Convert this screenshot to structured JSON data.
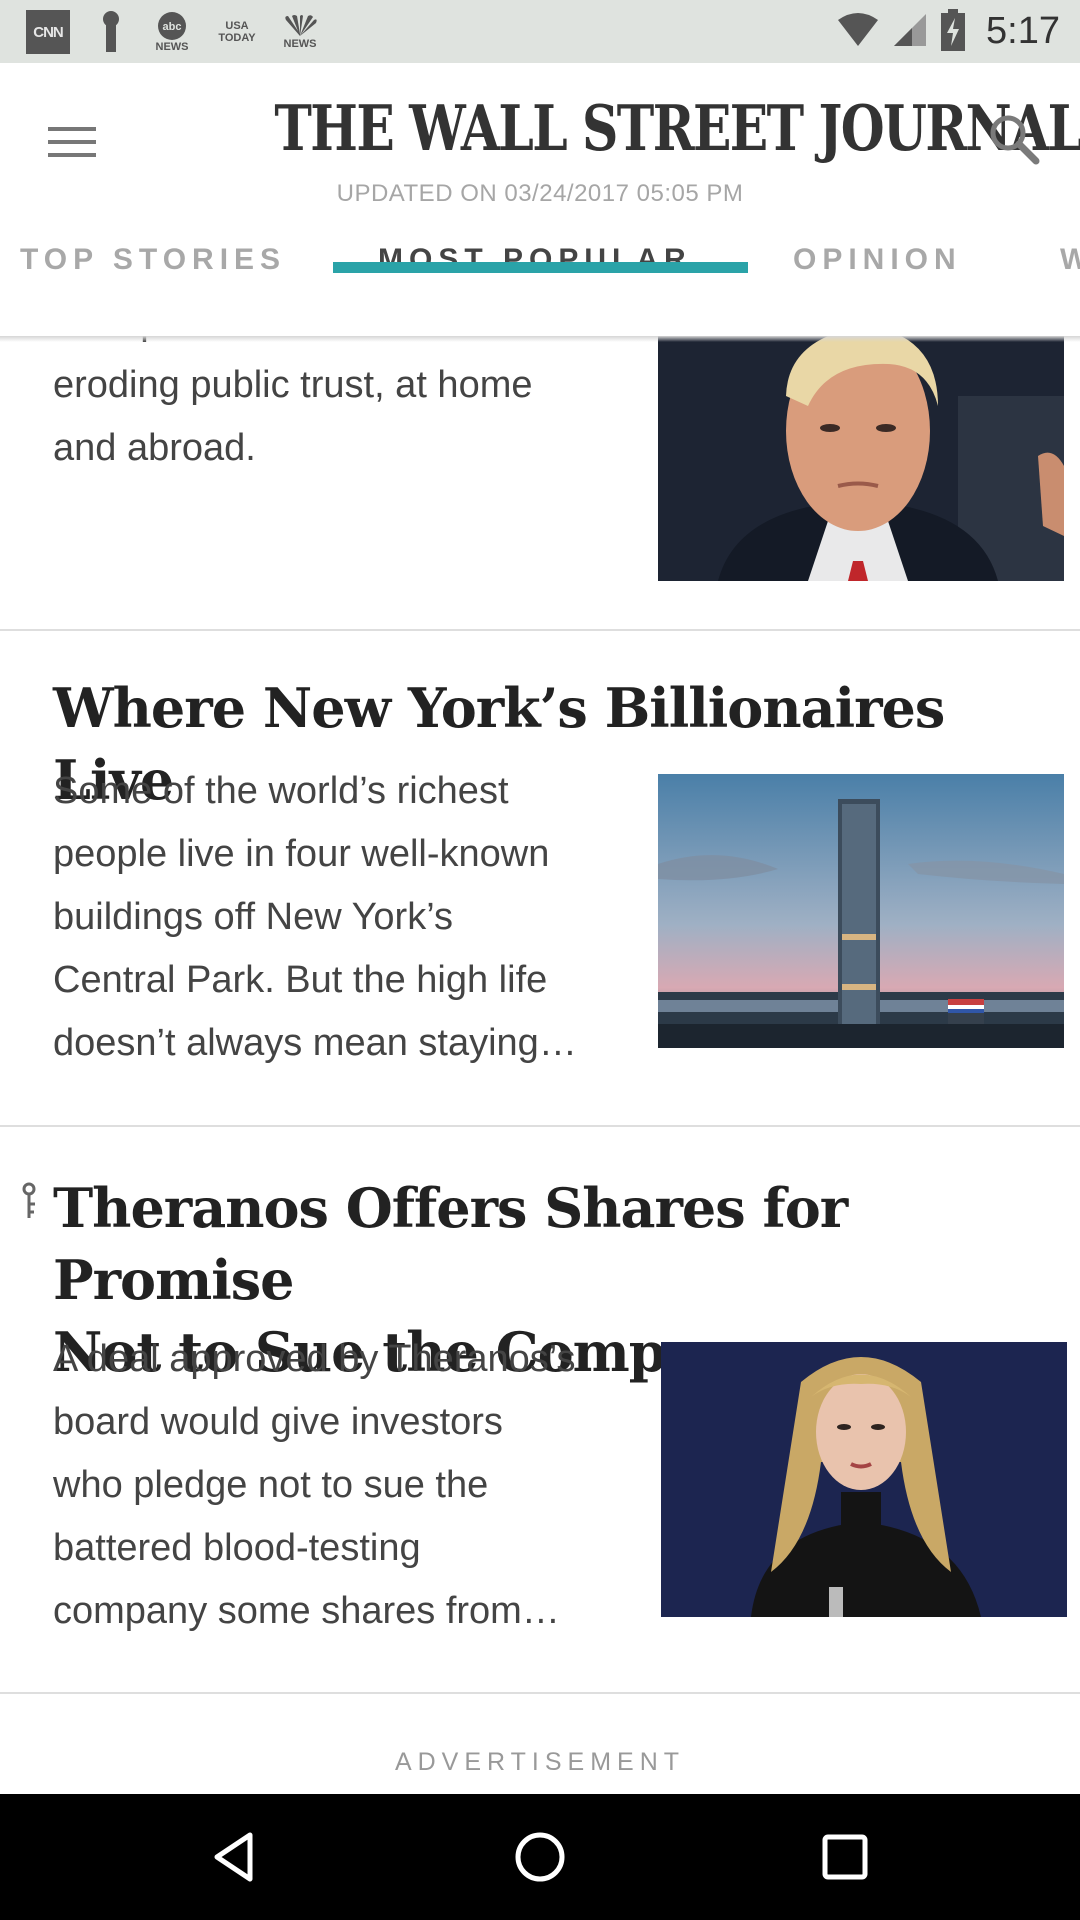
{
  "status_bar": {
    "notifications": [
      {
        "icon": "cnn-icon",
        "label": "CNN"
      },
      {
        "icon": "key-icon",
        "label": ""
      },
      {
        "icon": "abc-news-icon",
        "label": "abc",
        "sub": "NEWS"
      },
      {
        "icon": "usa-today-icon",
        "label": "USA",
        "sub": "TODAY"
      },
      {
        "icon": "nbc-news-icon",
        "label": "",
        "sub": "NEWS"
      }
    ],
    "time": "5:17"
  },
  "header": {
    "masthead": "THE WALL STREET JOURNAL.",
    "updated": "UPDATED ON 03/24/2017 05:05 PM"
  },
  "tabs": [
    {
      "label": "TOP STORIES",
      "active": false
    },
    {
      "label": "MOST POPULAR",
      "active": true
    },
    {
      "label": "OPINION",
      "active": false
    },
    {
      "label": "W",
      "active": false
    }
  ],
  "articles": [
    {
      "title": "",
      "summary_lines": [
        "Trump's falsehoods are",
        "eroding public trust, at home",
        "and abroad."
      ],
      "image": "trump-portrait-photo"
    },
    {
      "title": "Where New York’s Billionaires Live",
      "summary_lines": [
        "Some of the world’s richest",
        "people live in four well-known",
        "buildings off New York’s",
        "Central Park. But the high life",
        "doesn’t always mean staying…"
      ],
      "image": "nyc-skyscraper-photo"
    },
    {
      "title_lines": [
        "Theranos Offers Shares for Promise",
        "Not to Sue the Company"
      ],
      "summary_lines": [
        "A deal approved by Theranos’s",
        "board would give investors",
        "who pledge not to sue the",
        "battered blood-testing",
        "company some shares from…"
      ],
      "image": "elizabeth-holmes-photo",
      "badge": "key-icon"
    }
  ],
  "advertisement_label": "ADVERTISEMENT",
  "colors": {
    "accent": "#2aa3a8",
    "status_bar": "#dfe3df",
    "nav_bar": "#000000"
  }
}
